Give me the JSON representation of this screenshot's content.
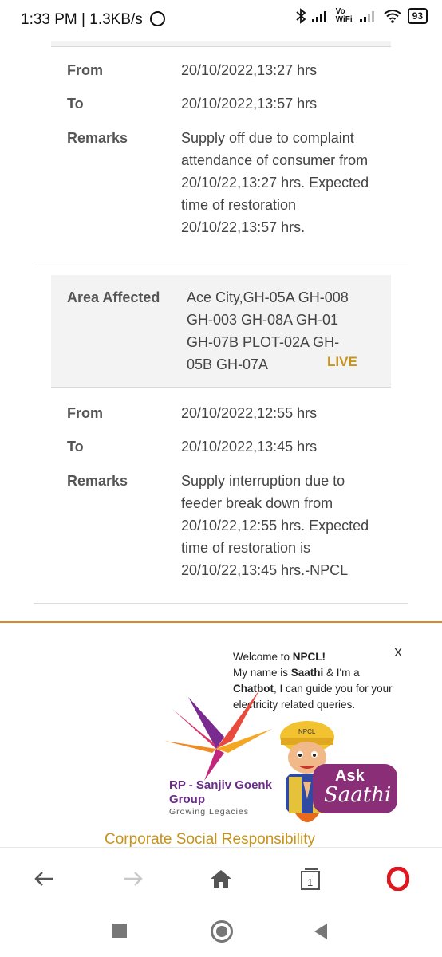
{
  "status_bar": {
    "time_speed": "1:33 PM | 1.3KB/s",
    "vowifi": "Vo WiFi",
    "battery": "93"
  },
  "outage1": {
    "from_label": "From",
    "from_value": "20/10/2022,13:27 hrs",
    "to_label": "To",
    "to_value": "20/10/2022,13:57 hrs",
    "remarks_label": "Remarks",
    "remarks_value": "Supply off due to complaint attendance of consumer from 20/10/22,13:27 hrs. Expected time of restoration 20/10/22,13:57 hrs."
  },
  "outage2": {
    "area_label": "Area Affected",
    "area_value": "Ace City,GH-05A GH-008 GH-003 GH-08A GH-01 GH-07B PLOT-02A GH-05B GH-07A",
    "live_badge": "LIVE",
    "from_label": "From",
    "from_value": "20/10/2022,12:55 hrs",
    "to_label": "To",
    "to_value": "20/10/2022,13:45 hrs",
    "remarks_label": "Remarks",
    "remarks_value": "Supply interruption due to feeder break down from 20/10/22,12:55 hrs. Expected time of restoration is 20/10/22,13:45 hrs.-NPCL"
  },
  "chatbot": {
    "welcome_prefix": "Welcome to ",
    "brand": "NPCL!",
    "line2_prefix": "My name is ",
    "bot_name": "Saathi",
    "line2_suffix": " & I'm a",
    "bot_type": "Chatbot",
    "line3_suffix": ", I can guide you for your electricity related queries.",
    "close_label": "X",
    "ask_label": "Ask",
    "saathi_label": "Saathi",
    "mascot_cap_text": "NPCL"
  },
  "group_logo": {
    "name_line1": "RP - Sanjiv Goenk",
    "name_line2": "Group",
    "tagline": "Growing Legacies"
  },
  "csr_link": "Corporate Social Responsibility",
  "browser_nav": {
    "tabs_count": "1"
  },
  "colors": {
    "accent_gold": "#c8931a",
    "divider_orange": "#d98a2b",
    "saathi_purple": "#8a2f77",
    "opera_red": "#e0161e"
  }
}
